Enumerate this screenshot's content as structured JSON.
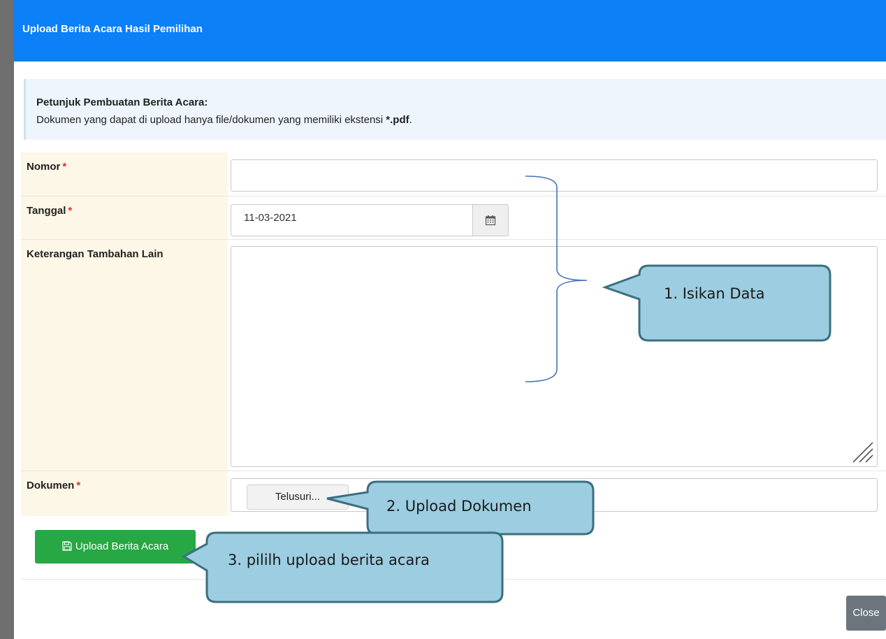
{
  "modal": {
    "title": "Upload Berita Acara Hasil Pemilihan",
    "info_title": "Petunjuk Pembuatan Berita Acara:",
    "info_text_before": "Dokumen yang dapat di upload hanya file/dokumen yang memiliki ekstensi ",
    "info_text_ext": "*.pdf",
    "info_text_after": "."
  },
  "form": {
    "nomor_label": "Nomor",
    "nomor_value": "",
    "tanggal_label": "Tanggal",
    "tanggal_value": "11-03-2021",
    "keterangan_label": "Keterangan Tambahan Lain",
    "keterangan_value": "",
    "dokumen_label": "Dokumen",
    "required_mark": "*",
    "browse_label": "Telusuri..."
  },
  "actions": {
    "upload_label": "Upload Berita Acara",
    "close_label": "Close"
  },
  "callouts": {
    "step1": "1.   Isikan Data",
    "step2": "2. Upload Dokumen",
    "step3": "3. pililh upload berita acara"
  },
  "colors": {
    "header": "#0b80f7",
    "upload_button": "#28a745",
    "close_button": "#6c757d",
    "callout_fill": "#9ccde0",
    "callout_stroke": "#3a6f80",
    "label_bg": "#fdf7e7",
    "required": "#d9302c"
  },
  "icons": {
    "calendar": "calendar-icon",
    "save": "save-icon",
    "resize": "resize-grip-icon"
  }
}
